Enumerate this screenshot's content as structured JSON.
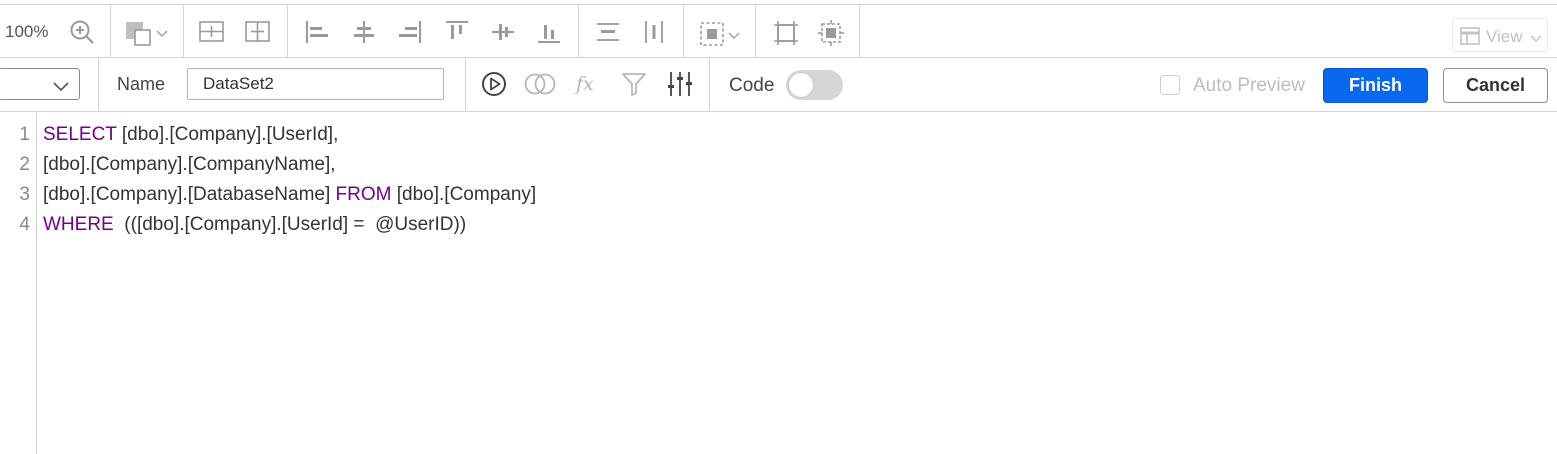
{
  "toolbar": {
    "zoom_level": "100%",
    "icons": [
      "zoom-in-icon",
      "fill-color-icon",
      "chevron-down-icon",
      "distribute-vertical-icon",
      "distribute-horizontal-icon",
      "align-left-icon",
      "align-center-icon",
      "align-right-icon",
      "align-top-icon",
      "align-middle-icon",
      "align-bottom-icon",
      "space-vertical-icon",
      "space-horizontal-icon",
      "group-select-icon",
      "fit-to-page-icon",
      "fit-center-icon"
    ],
    "view_label": "View"
  },
  "dataset_toolbar": {
    "name_label": "Name",
    "name_value": "DataSet2",
    "icons": [
      "run-query-icon",
      "join-icon",
      "expression-icon",
      "filter-icon",
      "parameters-icon"
    ],
    "code_label": "Code",
    "code_toggle_on": false,
    "auto_preview_label": "Auto Preview",
    "auto_preview_checked": false,
    "finish_label": "Finish",
    "cancel_label": "Cancel"
  },
  "editor": {
    "lines": [
      {
        "num": "1",
        "kw1": "SELECT",
        "text1": " [dbo].[Company].[UserId],",
        "kw2": "",
        "text2": ""
      },
      {
        "num": "2",
        "kw1": "",
        "text1": "[dbo].[Company].[CompanyName],",
        "kw2": "",
        "text2": ""
      },
      {
        "num": "3",
        "kw1": "",
        "text1": "[dbo].[Company].[DatabaseName] ",
        "kw2": "FROM",
        "text2": " [dbo].[Company]"
      },
      {
        "num": "4",
        "kw1": "WHERE",
        "text1": "  (([dbo].[Company].[UserId] =  @UserID))",
        "kw2": "",
        "text2": ""
      }
    ]
  },
  "colors": {
    "keyword": "#770088",
    "primary_button": "#0868f0",
    "border": "#d4d4d4"
  }
}
